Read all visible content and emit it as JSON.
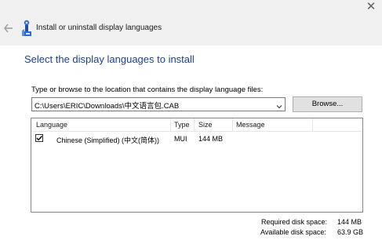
{
  "window": {
    "title": "Install or uninstall display languages",
    "close_glyph": "✕"
  },
  "page": {
    "heading": "Select the display languages to install",
    "prompt": "Type or browse to the location that contains the display language files:",
    "path_value": "C:\\Users\\ERIC\\Downloads\\中文语言包.CAB",
    "browse_label": "Browse..."
  },
  "list": {
    "columns": [
      "Language",
      "Type",
      "Size",
      "Message"
    ],
    "rows": [
      {
        "checked": true,
        "language": "Chinese (Simplified) (中文(简体))",
        "type": "MUI",
        "size": "144 MB",
        "message": ""
      }
    ]
  },
  "disk": {
    "required_label": "Required disk space:",
    "required_value": "144 MB",
    "available_label": "Available disk space:",
    "available_value": "63.9 GB"
  },
  "icons": {
    "back": "back-arrow-icon",
    "wizard": "language-install-icon",
    "dropdown": "chevron-down-icon",
    "check": "checkmark-icon"
  },
  "colors": {
    "heading": "#1c3f95",
    "titlebar": "#f0f0f0",
    "button": "#e1e1e1"
  }
}
